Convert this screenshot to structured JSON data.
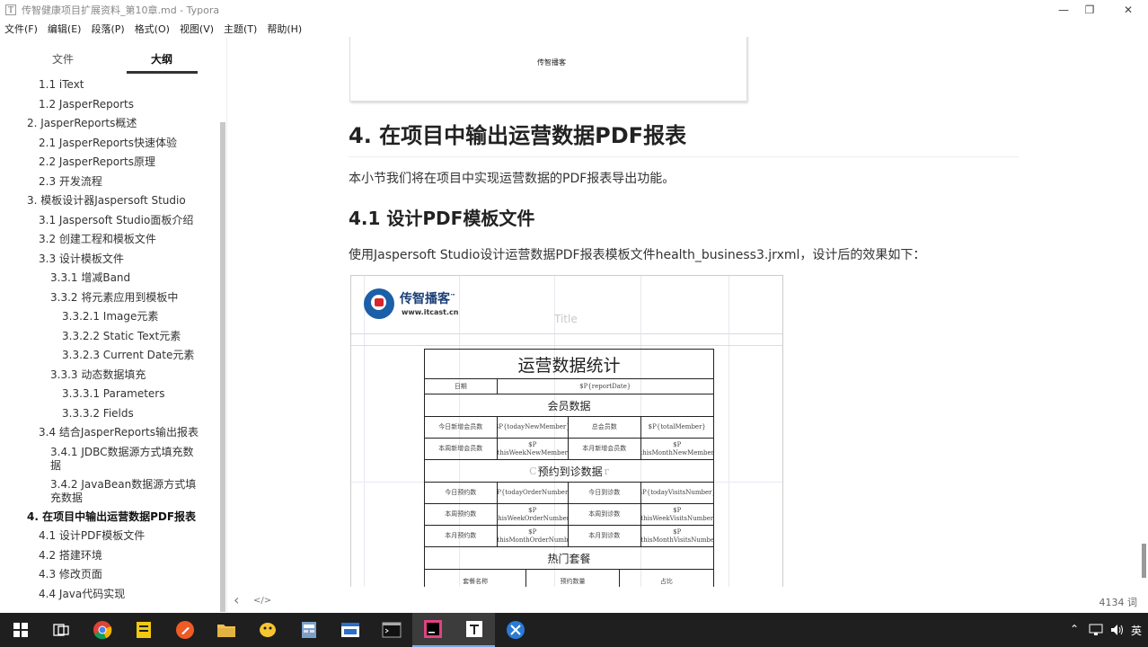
{
  "window": {
    "app_icon": "T",
    "title": "传智健康项目扩展资料_第10章.md - Typora",
    "controls": [
      "—",
      "❐",
      "✕"
    ]
  },
  "menu": [
    "文件(F)",
    "编辑(E)",
    "段落(P)",
    "格式(O)",
    "视图(V)",
    "主题(T)",
    "帮助(H)"
  ],
  "sidebar": {
    "tabs": [
      "文件",
      "大纲"
    ],
    "active_tab": "大纲",
    "outline": [
      {
        "label": "1.1 iText",
        "level": 2
      },
      {
        "label": "1.2 JasperReports",
        "level": 2
      },
      {
        "label": "2. JasperReports概述",
        "level": 1
      },
      {
        "label": "2.1 JasperReports快速体验",
        "level": 2
      },
      {
        "label": "2.2 JasperReports原理",
        "level": 2
      },
      {
        "label": "2.3 开发流程",
        "level": 2
      },
      {
        "label": "3. 模板设计器Jaspersoft Studio",
        "level": 1
      },
      {
        "label": "3.1 Jaspersoft Studio面板介绍",
        "level": 2
      },
      {
        "label": "3.2 创建工程和模板文件",
        "level": 2
      },
      {
        "label": "3.3 设计模板文件",
        "level": 2
      },
      {
        "label": "3.3.1 增减Band",
        "level": 3
      },
      {
        "label": "3.3.2 将元素应用到模板中",
        "level": 3
      },
      {
        "label": "3.3.2.1 Image元素",
        "level": 4
      },
      {
        "label": "3.3.2.2 Static Text元素",
        "level": 4
      },
      {
        "label": "3.3.2.3 Current Date元素",
        "level": 4
      },
      {
        "label": "3.3.3 动态数据填充",
        "level": 3
      },
      {
        "label": "3.3.3.1 Parameters",
        "level": 4
      },
      {
        "label": "3.3.3.2 Fields",
        "level": 4
      },
      {
        "label": "3.4 结合JasperReports输出报表",
        "level": 2
      },
      {
        "label": "3.4.1 JDBC数据源方式填充数据",
        "level": 3,
        "wrap": true
      },
      {
        "label": "3.4.2 JavaBean数据源方式填充数据",
        "level": 3,
        "wrap": true
      },
      {
        "label": "4. 在项目中输出运营数据PDF报表",
        "level": 1,
        "active": true
      },
      {
        "label": "4.1 设计PDF模板文件",
        "level": 2
      },
      {
        "label": "4.2 搭建环境",
        "level": 2
      },
      {
        "label": "4.3 修改页面",
        "level": 2
      },
      {
        "label": "4.4 Java代码实现",
        "level": 2
      }
    ]
  },
  "content": {
    "prev_image_caption": "传智播客",
    "h1": "4. 在项目中输出运营数据PDF报表",
    "p1": "本小节我们将在项目中实现运营数据的PDF报表导出功能。",
    "h2": "4.1 设计PDF模板文件",
    "p2": "使用Jaspersoft Studio设计运营数据PDF报表模板文件health_business3.jrxml，设计后的效果如下：",
    "report": {
      "logo_text": "传智播客",
      "logo_tm": "™",
      "logo_url": "www.itcast.cn",
      "band_title": "Title",
      "overlay_letter_c": "C",
      "overlay_letter_r": "r",
      "table_title": "运营数据统计",
      "date_label": "日期",
      "date_value": "$P{reportDate}",
      "section_member": "会员数据",
      "member_rows": [
        [
          "今日新增会员数",
          "$P{todayNewMember}",
          "总会员数",
          "$P{totalMember}"
        ],
        [
          "本周新增会员数",
          "$P\n{thisWeekNewMember}",
          "本月新增会员数",
          "$P\n{thisMonthNewMember}"
        ]
      ],
      "section_visit": "预约到诊数据",
      "visit_rows": [
        [
          "今日预约数",
          "$P{todayOrderNumber}",
          "今日到诊数",
          "$P{todayVisitsNumber}"
        ],
        [
          "本周预约数",
          "$P\n{thisWeekOrderNumber}",
          "本周到诊数",
          "$P\n{thisWeekVisitsNumber}"
        ],
        [
          "本月预约数",
          "$P\n{thisMonthOrderNumbe",
          "本月到诊数",
          "$P\n{thisMonthVisitsNumber"
        ]
      ],
      "section_hot": "热门套餐",
      "hot_header": [
        "套餐名称",
        "预约数量",
        "占比"
      ]
    }
  },
  "statusbar": {
    "back_icon": "‹",
    "code_icon": "</>",
    "word_count": "4134 词"
  },
  "taskbar": {
    "tray_caret": "⌃",
    "ime": "英"
  }
}
